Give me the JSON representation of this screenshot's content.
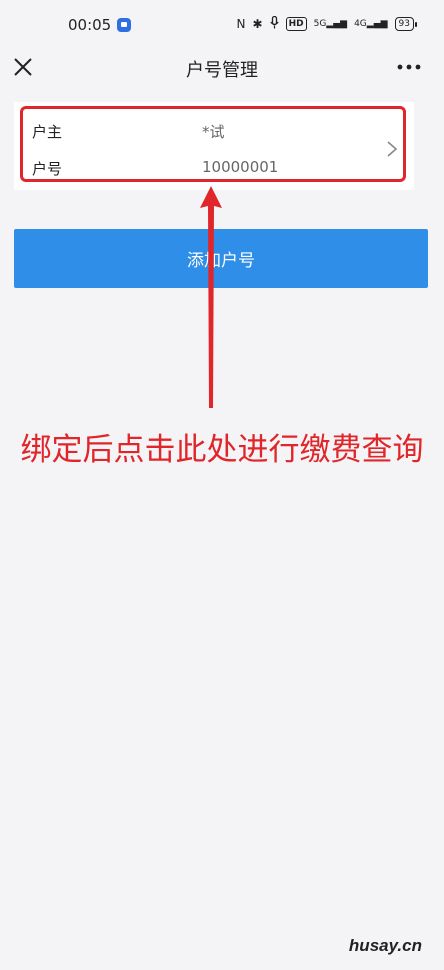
{
  "status_bar": {
    "time": "00:05",
    "network_5g": "5G",
    "network_4g": "4G",
    "hd_label": "HD",
    "battery": "93"
  },
  "nav": {
    "title": "户号管理"
  },
  "account": {
    "owner_label": "户主",
    "owner_value": "*试",
    "number_label": "户号",
    "number_value": "10000001"
  },
  "add_button_label": "添加户号",
  "instruction": "绑定后点击此处进行缴费查询",
  "watermark": "husay.cn",
  "colors": {
    "accent_blue": "#2f8ee8",
    "annotation_red": "#e0262a",
    "background": "#f4f4f6"
  }
}
